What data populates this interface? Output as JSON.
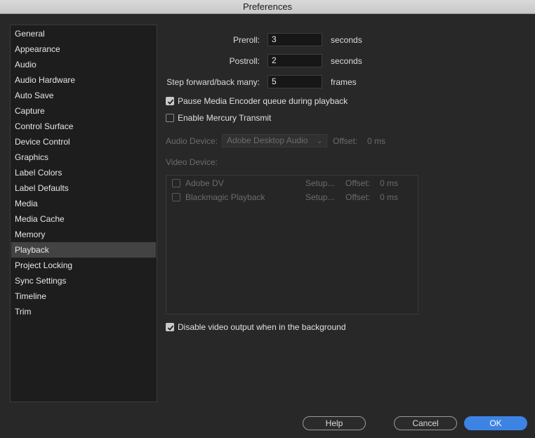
{
  "window": {
    "title": "Preferences"
  },
  "sidebar": {
    "items": [
      {
        "label": "General"
      },
      {
        "label": "Appearance"
      },
      {
        "label": "Audio"
      },
      {
        "label": "Audio Hardware"
      },
      {
        "label": "Auto Save"
      },
      {
        "label": "Capture"
      },
      {
        "label": "Control Surface"
      },
      {
        "label": "Device Control"
      },
      {
        "label": "Graphics"
      },
      {
        "label": "Label Colors"
      },
      {
        "label": "Label Defaults"
      },
      {
        "label": "Media"
      },
      {
        "label": "Media Cache"
      },
      {
        "label": "Memory"
      },
      {
        "label": "Playback"
      },
      {
        "label": "Project Locking"
      },
      {
        "label": "Sync Settings"
      },
      {
        "label": "Timeline"
      },
      {
        "label": "Trim"
      }
    ],
    "selected": "Playback"
  },
  "playback": {
    "preroll": {
      "label": "Preroll:",
      "value": "3",
      "unit": "seconds"
    },
    "postroll": {
      "label": "Postroll:",
      "value": "2",
      "unit": "seconds"
    },
    "step": {
      "label": "Step forward/back many:",
      "value": "5",
      "unit": "frames"
    },
    "pause_encoder": {
      "label": "Pause Media Encoder queue during playback",
      "checked": true
    },
    "mercury": {
      "label": "Enable Mercury Transmit",
      "checked": false
    },
    "audio_device": {
      "label": "Audio Device:",
      "value": "Adobe Desktop Audio",
      "offset_label": "Offset:",
      "offset_value": "0 ms"
    },
    "video_device": {
      "label": "Video Device:",
      "devices": [
        {
          "name": "Adobe DV",
          "setup": "Setup...",
          "offset_label": "Offset:",
          "offset_value": "0 ms"
        },
        {
          "name": "Blackmagic Playback",
          "setup": "Setup...",
          "offset_label": "Offset:",
          "offset_value": "0 ms"
        }
      ]
    },
    "disable_video": {
      "label": "Disable video output when in the background",
      "checked": true
    }
  },
  "buttons": {
    "help": "Help",
    "cancel": "Cancel",
    "ok": "OK"
  },
  "colors": {
    "accent": "#3d83e4",
    "selection": "#434343",
    "background": "#282828"
  },
  "icons": {
    "checkmark": "checkmark-icon",
    "dropdown": "chevron-down-icon"
  }
}
